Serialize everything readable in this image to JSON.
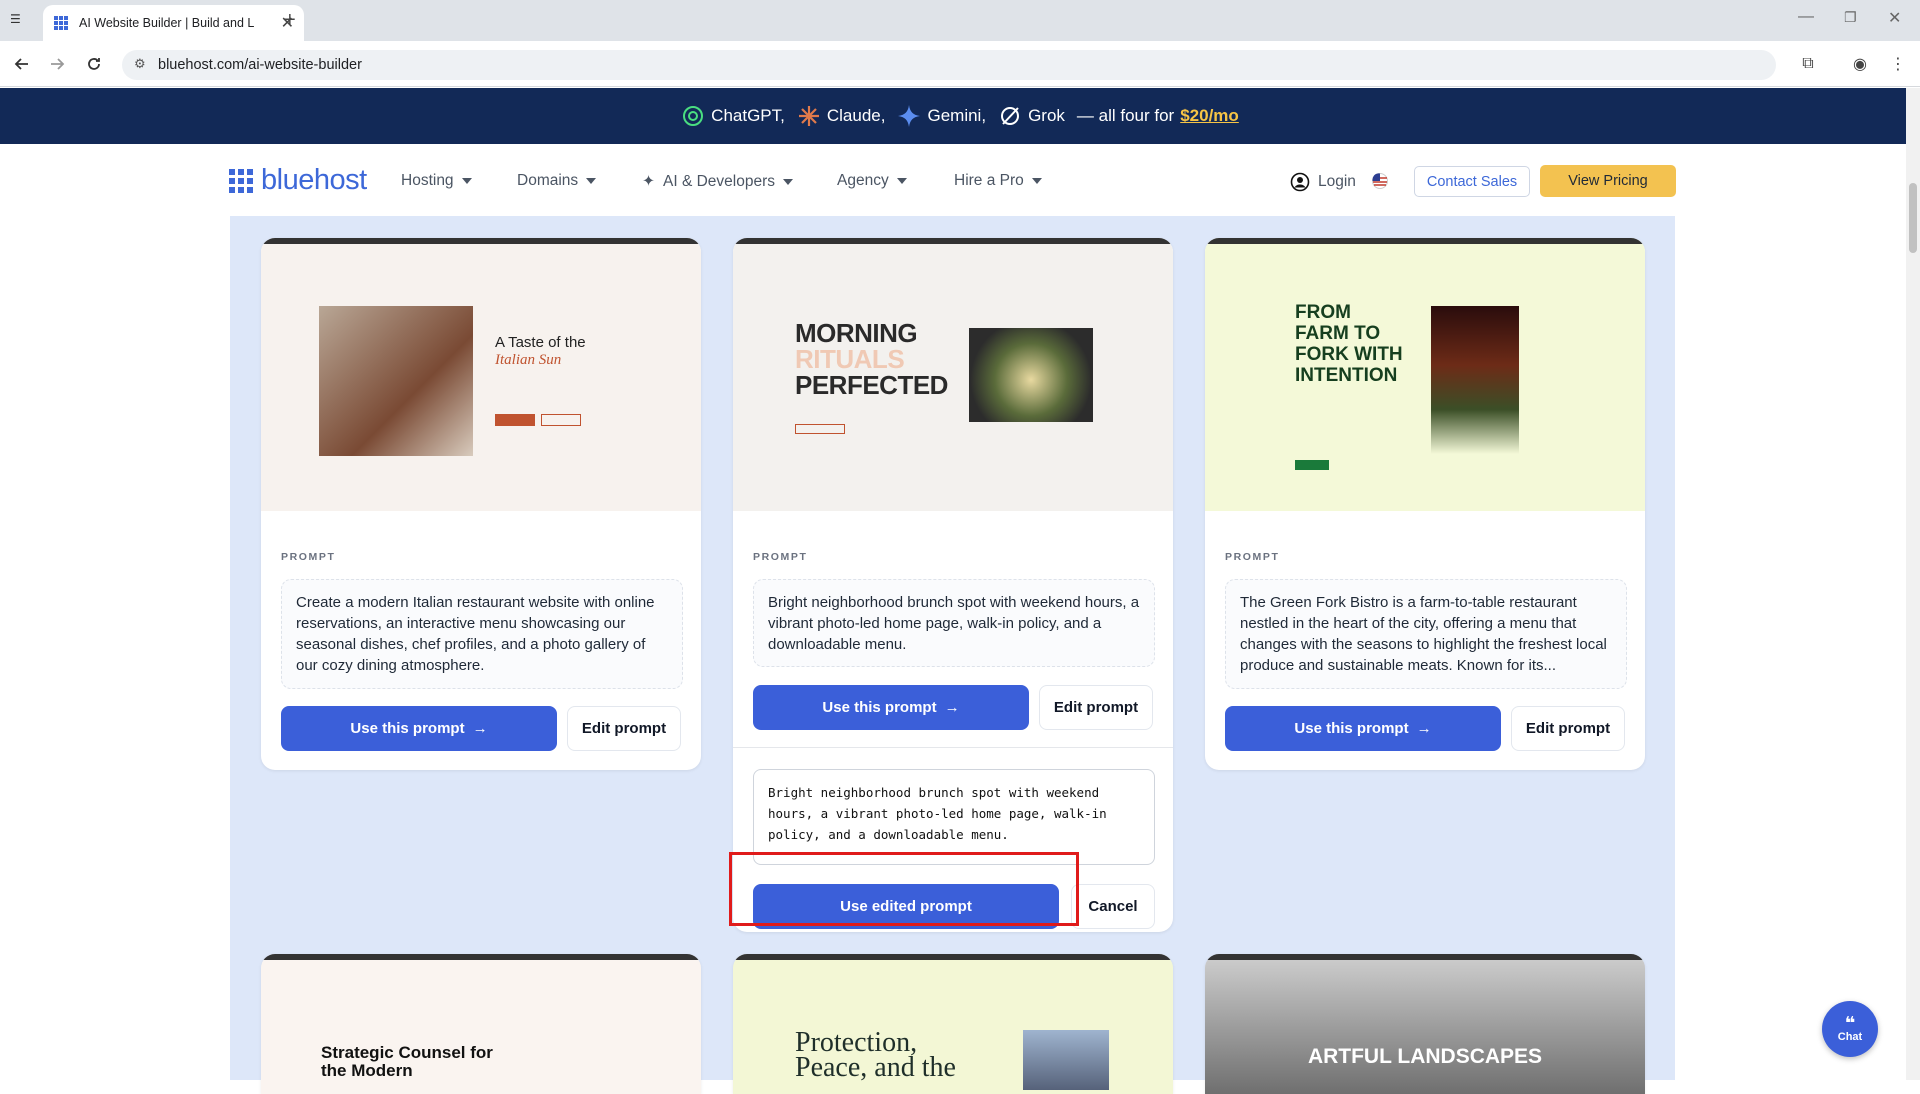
{
  "browser": {
    "tab_title": "AI Website Builder | Build and L",
    "url": "bluehost.com/ai-website-builder"
  },
  "promo": {
    "items": [
      "ChatGPT,",
      "Claude,",
      "Gemini,",
      "Grok"
    ],
    "tail": "— all four for",
    "price": "$20/mo"
  },
  "nav": {
    "logo": "bluehost",
    "items": [
      "Hosting",
      "Domains",
      "AI & Developers",
      "Agency",
      "Hire a Pro"
    ],
    "login": "Login",
    "contact": "Contact Sales",
    "pricing": "View Pricing"
  },
  "cards": [
    {
      "thumb_heading_1": "A Taste of the",
      "thumb_heading_2": "Italian Sun",
      "label": "PROMPT",
      "prompt": "Create a modern Italian restaurant website with online reservations, an interactive menu showcasing our seasonal dishes, chef profiles, and a photo gallery of our cozy dining atmosphere.",
      "use": "Use this prompt",
      "edit": "Edit prompt"
    },
    {
      "thumb_heading_1": "MORNING",
      "thumb_heading_2": "RITUALS",
      "thumb_heading_3": "PERFECTED",
      "label": "PROMPT",
      "prompt": "Bright neighborhood brunch spot with weekend hours, a vibrant photo-led home page, walk-in policy, and a downloadable menu.",
      "use": "Use this prompt",
      "edit": "Edit prompt",
      "edited_text": "Bright neighborhood brunch spot with weekend hours, a vibrant photo-led home page, walk-in policy, and a downloadable menu.",
      "use_edited": "Use edited prompt",
      "cancel": "Cancel"
    },
    {
      "thumb_heading": "FROM FARM TO FORK WITH INTENTION",
      "label": "PROMPT",
      "prompt": "The Green Fork Bistro is a farm-to-table restaurant nestled in the heart of the city, offering a menu that changes with the seasons to highlight the freshest local produce and sustainable meats. Known for its...",
      "use": "Use this prompt",
      "edit": "Edit prompt"
    }
  ],
  "row2": [
    {
      "heading": "Strategic Counsel for the Modern"
    },
    {
      "heading": "Protection, Peace, and the"
    },
    {
      "heading": "ARTFUL LANDSCAPES"
    }
  ],
  "chat": "Chat"
}
